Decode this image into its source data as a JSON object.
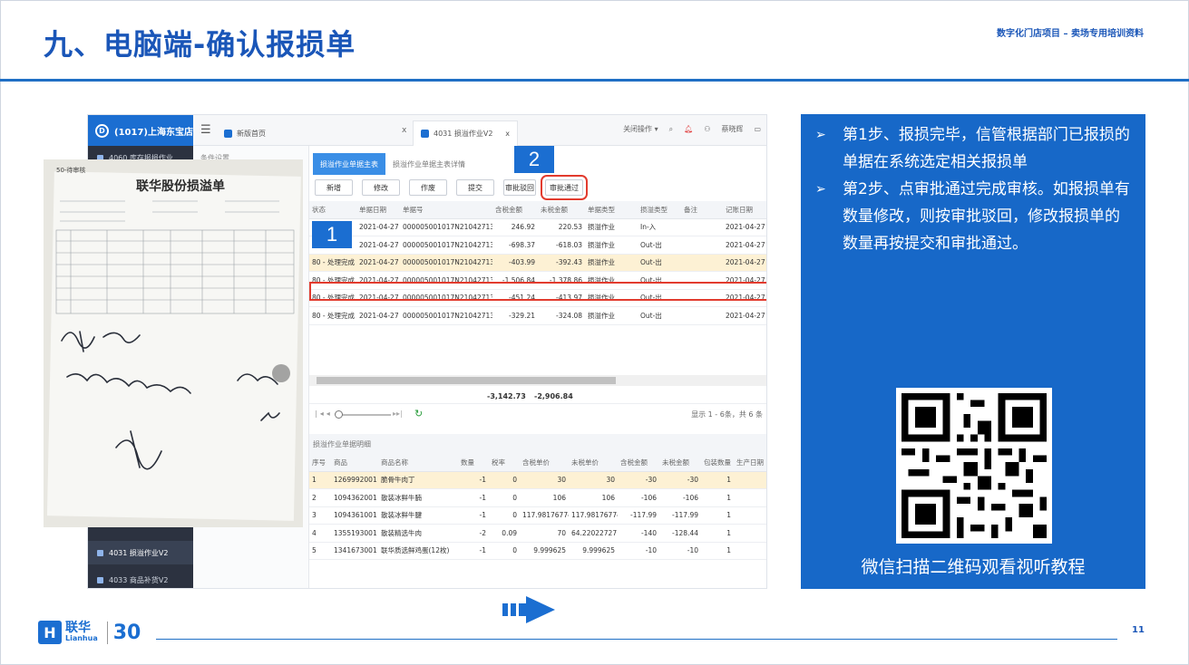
{
  "header": {
    "title": "九、电脑端-确认报损单",
    "note": "数字化门店项目 – 卖场专用培训资料"
  },
  "app": {
    "store_name": "(1017)上海东宝店",
    "sidebar": {
      "top_item": "4060 库存报损作业",
      "bottom_items": [
        "4031 损溢作业V2",
        "4033 商品补货V2"
      ]
    },
    "tabs": [
      "新版首页",
      "4031 损溢作业V2"
    ],
    "top_actions": {
      "close_ops": "关闭操作 ▾",
      "user": "蔡晓辉"
    },
    "leftnav_label": "条件设置",
    "subtabs": [
      "损溢作业单据主表",
      "损溢作业单据主表详情"
    ],
    "buttons": [
      "新增",
      "修改",
      "作废",
      "提交",
      "审批驳回",
      "审批通过"
    ],
    "main_table": {
      "columns": [
        "状态",
        "单据日期",
        "单据号",
        "含税金额",
        "未税金额",
        "单据类型",
        "损溢类型",
        "备注",
        "记账日期"
      ],
      "rows": [
        [
          "",
          "2021-04-27",
          "000005001017N2104271391",
          "246.92",
          "220.53",
          "损溢作业",
          "In-入",
          "",
          "2021-04-27"
        ],
        [
          "",
          "2021-04-27",
          "000005001017N2104271394",
          "-698.37",
          "-618.03",
          "损溢作业",
          "Out-出",
          "",
          "2021-04-27"
        ],
        [
          "80 - 处理完成",
          "2021-04-27",
          "000005001017N2104271395",
          "-403.99",
          "-392.43",
          "损溢作业",
          "Out-出",
          "",
          "2021-04-27"
        ],
        [
          "80 - 处理完成",
          "2021-04-27",
          "000005001017N2104271396",
          "-1,506.84",
          "-1,378.86",
          "损溢作业",
          "Out-出",
          "",
          "2021-04-27"
        ],
        [
          "80 - 处理完成",
          "2021-04-27",
          "000005001017N2104271397",
          "-451.24",
          "-413.97",
          "损溢作业",
          "Out-出",
          "",
          "2021-04-27"
        ],
        [
          "80 - 处理完成",
          "2021-04-27",
          "000005001017N2104271399",
          "-329.21",
          "-324.08",
          "损溢作业",
          "Out-出",
          "",
          "2021-04-27"
        ]
      ],
      "totals": [
        "-3,142.73",
        "-2,906.84"
      ],
      "pager_info": "显示 1 - 6条，共 6 条"
    },
    "detail_section_title": "损溢作业单据明细",
    "detail_table": {
      "columns": [
        "序号",
        "商品",
        "商品名称",
        "数量",
        "税率",
        "含税单价",
        "未税单价",
        "含税金额",
        "未税金额",
        "包装数量",
        "生产日期"
      ],
      "rows": [
        [
          "1",
          "1269992001",
          "脆骨牛肉丁",
          "-1",
          "0",
          "30",
          "30",
          "-30",
          "-30",
          "1",
          ""
        ],
        [
          "2",
          "1094362001",
          "散装冰鲜牛腩",
          "-1",
          "0",
          "106",
          "106",
          "-106",
          "-106",
          "1",
          ""
        ],
        [
          "3",
          "1094361001",
          "散装冰鲜牛腱",
          "-1",
          "0",
          "117.98176774",
          "117.98176774",
          "-117.99",
          "-117.99",
          "1",
          ""
        ],
        [
          "4",
          "1355193001",
          "散装精选牛肉",
          "-2",
          "0.09",
          "70",
          "64.22022727",
          "-140",
          "-128.44",
          "1",
          ""
        ],
        [
          "5",
          "1341673001",
          "联华质选鲜鸡蛋(12枚)",
          "-1",
          "0",
          "9.999625",
          "9.999625",
          "-10",
          "-10",
          "1",
          ""
        ]
      ]
    },
    "badges": [
      "1",
      "2"
    ]
  },
  "photo": {
    "doc_title": "联华股份损溢单",
    "doc_corner": "50-待审核"
  },
  "panel": {
    "steps": [
      {
        "arrow": "➢",
        "text": "第1步、报损完毕，信管根据部门已报损的单据在系统选定相关报损单"
      },
      {
        "arrow": "➢",
        "text": "第2步、点审批通过完成审核。如报损单有数量修改，则按审批驳回，修改报损单的数量再按提交和审批通过。"
      }
    ],
    "qr_caption": "微信扫描二维码观看视听教程"
  },
  "footer": {
    "logo_mark": "H",
    "logo_cn": "联华",
    "logo_en": "Lianhua",
    "logo_30": "30",
    "page_number": "11"
  },
  "colors": {
    "brand_blue": "#1b6ed1",
    "title_blue": "#1a56b8",
    "highlight_red": "#e23b2e",
    "selected_row": "#fdf1d4"
  }
}
